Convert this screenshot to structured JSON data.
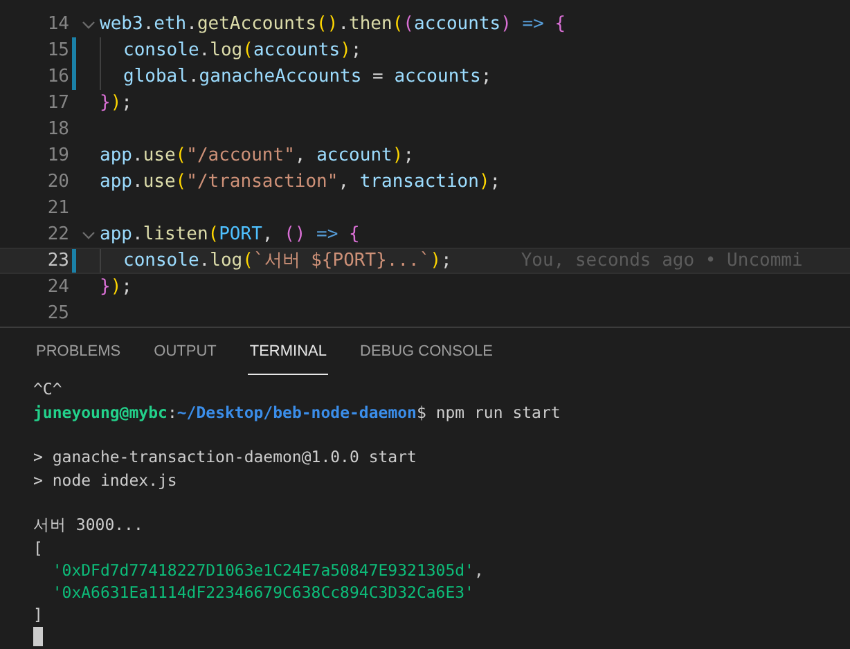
{
  "editor": {
    "lines": [
      {
        "number": "14",
        "fold": true,
        "gutter": false,
        "current": false,
        "tokens": [
          {
            "text": "web3",
            "color": "#9cdcfe"
          },
          {
            "text": ".",
            "color": "#d4d4d4"
          },
          {
            "text": "eth",
            "color": "#9cdcfe"
          },
          {
            "text": ".",
            "color": "#d4d4d4"
          },
          {
            "text": "getAccounts",
            "color": "#dcdcaa"
          },
          {
            "text": "()",
            "color": "#ffd700"
          },
          {
            "text": ".",
            "color": "#d4d4d4"
          },
          {
            "text": "then",
            "color": "#dcdcaa"
          },
          {
            "text": "(",
            "color": "#ffd700"
          },
          {
            "text": "(",
            "color": "#da70d6"
          },
          {
            "text": "accounts",
            "color": "#9cdcfe"
          },
          {
            "text": ")",
            "color": "#da70d6"
          },
          {
            "text": " => ",
            "color": "#569cd6"
          },
          {
            "text": "{",
            "color": "#da70d6"
          }
        ],
        "children": [
          {
            "number": "15",
            "fold": false,
            "gutter": true,
            "current": false,
            "tokens": [
              {
                "text": "console",
                "color": "#9cdcfe"
              },
              {
                "text": ".",
                "color": "#d4d4d4"
              },
              {
                "text": "log",
                "color": "#dcdcaa"
              },
              {
                "text": "(",
                "color": "#ffd700"
              },
              {
                "text": "accounts",
                "color": "#9cdcfe"
              },
              {
                "text": ")",
                "color": "#ffd700"
              },
              {
                "text": ";",
                "color": "#d4d4d4"
              }
            ]
          },
          {
            "number": "16",
            "fold": false,
            "gutter": true,
            "current": false,
            "tokens": [
              {
                "text": "global",
                "color": "#9cdcfe"
              },
              {
                "text": ".",
                "color": "#d4d4d4"
              },
              {
                "text": "ganacheAccounts",
                "color": "#9cdcfe"
              },
              {
                "text": " = ",
                "color": "#d4d4d4"
              },
              {
                "text": "accounts",
                "color": "#9cdcfe"
              },
              {
                "text": ";",
                "color": "#d4d4d4"
              }
            ]
          }
        ]
      },
      {
        "number": "17",
        "fold": false,
        "gutter": false,
        "current": false,
        "tokens": [
          {
            "text": "}",
            "color": "#da70d6"
          },
          {
            "text": ")",
            "color": "#ffd700"
          },
          {
            "text": ";",
            "color": "#d4d4d4"
          }
        ]
      },
      {
        "number": "18",
        "fold": false,
        "gutter": false,
        "current": false
      },
      {
        "number": "19",
        "fold": false,
        "gutter": false,
        "current": false,
        "tokens": [
          {
            "text": "app",
            "color": "#9cdcfe"
          },
          {
            "text": ".",
            "color": "#d4d4d4"
          },
          {
            "text": "use",
            "color": "#dcdcaa"
          },
          {
            "text": "(",
            "color": "#ffd700"
          },
          {
            "text": "\"/account\"",
            "color": "#ce9178"
          },
          {
            "text": ", ",
            "color": "#d4d4d4"
          },
          {
            "text": "account",
            "color": "#9cdcfe"
          },
          {
            "text": ")",
            "color": "#ffd700"
          },
          {
            "text": ";",
            "color": "#d4d4d4"
          }
        ]
      },
      {
        "number": "20",
        "fold": false,
        "gutter": false,
        "current": false,
        "tokens": [
          {
            "text": "app",
            "color": "#9cdcfe"
          },
          {
            "text": ".",
            "color": "#d4d4d4"
          },
          {
            "text": "use",
            "color": "#dcdcaa"
          },
          {
            "text": "(",
            "color": "#ffd700"
          },
          {
            "text": "\"/transaction\"",
            "color": "#ce9178"
          },
          {
            "text": ", ",
            "color": "#d4d4d4"
          },
          {
            "text": "transaction",
            "color": "#9cdcfe"
          },
          {
            "text": ")",
            "color": "#ffd700"
          },
          {
            "text": ";",
            "color": "#d4d4d4"
          }
        ]
      },
      {
        "number": "21",
        "fold": false,
        "gutter": false,
        "current": false
      },
      {
        "number": "22",
        "fold": true,
        "gutter": false,
        "current": false,
        "tokens": [
          {
            "text": "app",
            "color": "#9cdcfe"
          },
          {
            "text": ".",
            "color": "#d4d4d4"
          },
          {
            "text": "listen",
            "color": "#dcdcaa"
          },
          {
            "text": "(",
            "color": "#ffd700"
          },
          {
            "text": "PORT",
            "color": "#4fc1ff"
          },
          {
            "text": ", ",
            "color": "#d4d4d4"
          },
          {
            "text": "()",
            "color": "#da70d6"
          },
          {
            "text": " => ",
            "color": "#569cd6"
          },
          {
            "text": "{",
            "color": "#da70d6"
          }
        ],
        "children": [
          {
            "number": "23",
            "fold": false,
            "gutter": true,
            "current": true,
            "blame": "You, seconds ago • Uncommi",
            "tokens": [
              {
                "text": "console",
                "color": "#9cdcfe"
              },
              {
                "text": ".",
                "color": "#d4d4d4"
              },
              {
                "text": "log",
                "color": "#dcdcaa"
              },
              {
                "text": "(",
                "color": "#ffd700"
              },
              {
                "text": "`서버 ${PORT}...`",
                "color": "#ce9178"
              },
              {
                "text": ")",
                "color": "#ffd700"
              },
              {
                "text": ";",
                "color": "#d4d4d4"
              }
            ]
          }
        ]
      },
      {
        "number": "24",
        "fold": false,
        "gutter": false,
        "current": false,
        "tokens": [
          {
            "text": "}",
            "color": "#da70d6"
          },
          {
            "text": ")",
            "color": "#ffd700"
          },
          {
            "text": ";",
            "color": "#d4d4d4"
          }
        ]
      },
      {
        "number": "25",
        "fold": false,
        "gutter": false,
        "current": false
      }
    ]
  },
  "panel": {
    "tabs": [
      {
        "label": "PROBLEMS",
        "selected": false
      },
      {
        "label": "OUTPUT",
        "selected": false
      },
      {
        "label": "TERMINAL",
        "selected": true
      },
      {
        "label": "DEBUG CONSOLE",
        "selected": false
      }
    ],
    "terminal": [
      {
        "kind": "text",
        "segments": [
          {
            "text": "^C^",
            "kind": "plain"
          }
        ]
      },
      {
        "kind": "text",
        "segments": [
          {
            "text": "juneyoung@mybc",
            "kind": "user"
          },
          {
            "text": ":",
            "kind": "plain"
          },
          {
            "text": "~/Desktop/beb-node-daemon",
            "kind": "path"
          },
          {
            "text": "$ npm run start",
            "kind": "plain"
          }
        ]
      },
      {
        "kind": "blank"
      },
      {
        "kind": "text",
        "segments": [
          {
            "text": "> ganache-transaction-daemon@1.0.0 start",
            "kind": "plain"
          }
        ]
      },
      {
        "kind": "text",
        "segments": [
          {
            "text": "> node index.js",
            "kind": "plain"
          }
        ]
      },
      {
        "kind": "blank"
      },
      {
        "kind": "text",
        "segments": [
          {
            "text": "서버 3000...",
            "kind": "plain"
          }
        ]
      },
      {
        "kind": "text",
        "segments": [
          {
            "text": "[",
            "kind": "plain"
          }
        ]
      },
      {
        "kind": "text",
        "segments": [
          {
            "text": "  '0xDFd7d77418227D1063e1C24E7a50847E9321305d'",
            "kind": "string"
          },
          {
            "text": ",",
            "kind": "plain"
          }
        ]
      },
      {
        "kind": "text",
        "segments": [
          {
            "text": "  '0xA6631Ea1114dF22346679C638Cc894C3D32Ca6E3'",
            "kind": "string"
          }
        ]
      },
      {
        "kind": "text",
        "segments": [
          {
            "text": "]",
            "kind": "plain"
          }
        ]
      },
      {
        "kind": "cursor"
      }
    ]
  }
}
